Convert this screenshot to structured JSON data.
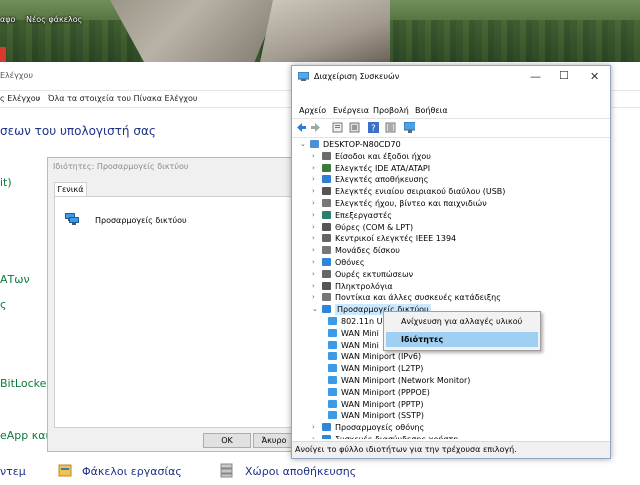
{
  "desktop": {
    "icon1_label": "αφο",
    "icon2_label": "Νέος φάκελος"
  },
  "control_panel": {
    "title_fragment": "Ελέγχου",
    "breadcrumb_prev": "ς Ελέγχου",
    "breadcrumb_sep": "›",
    "breadcrumb_current": "Όλα τα στοιχεία του Πίνακα Ελέγχου",
    "heading": "σεων του υπολογιστή σας",
    "links": [
      "it)",
      "ΑΤων",
      "ς",
      "BitLocker",
      "eApp και"
    ],
    "bottom_items": [
      "ντεμ",
      "Φάκελοι εργασίας",
      "Χώροι αποθήκευσης"
    ]
  },
  "properties_dialog": {
    "title": "Ιδιότητες: Προσαρμογείς δικτύου",
    "tab_general": "Γενικά",
    "device_label": "Προσαρμογείς δικτύου",
    "ok_button": "ΟΚ",
    "cancel_button": "Άκυρο"
  },
  "device_manager": {
    "title": "Διαχείριση Συσκευών",
    "menu": [
      "Αρχείο",
      "Ενέργεια",
      "Προβολή",
      "Βοήθεια"
    ],
    "computer": "DESKTOP-N80CD70",
    "categories": [
      "Είσοδοι και έξοδοι ήχου",
      "Ελεγκτές IDE ATA/ATAPI",
      "Ελεγκτές αποθήκευσης",
      "Ελεγκτές ενιαίου σειριακού διαύλου (USB)",
      "Ελεγκτές ήχου, βίντεο και παιχνιδιών",
      "Επεξεργαστές",
      "Θύρες (COM & LPT)",
      "Κεντρικοί ελεγκτές IEEE 1394",
      "Μονάδες δίσκου",
      "Οθόνες",
      "Ουρές εκτυπώσεων",
      "Πληκτρολόγια",
      "Ποντίκια και άλλες συσκευές κατάδειξης",
      "Προσαρμογείς δικτύου"
    ],
    "network_children": [
      "802.11n U",
      "WAN Mini",
      "WAN Mini",
      "WAN Miniport (IPv6)",
      "WAN Miniport (L2TP)",
      "WAN Miniport (Network Monitor)",
      "WAN Miniport (PPPOE)",
      "WAN Miniport (PPTP)",
      "WAN Miniport (SSTP)"
    ],
    "after_categories": [
      "Προσαρμογείς οθόνης",
      "Συσκευές διασύνδεσης χρήστη"
    ],
    "status": "Ανοίγει το φύλλο ιδιοτήτων για την τρέχουσα επιλογή."
  },
  "context_menu": {
    "items": [
      "Ανίχνευση για αλλαγές υλικού",
      "Ιδιότητες"
    ]
  }
}
